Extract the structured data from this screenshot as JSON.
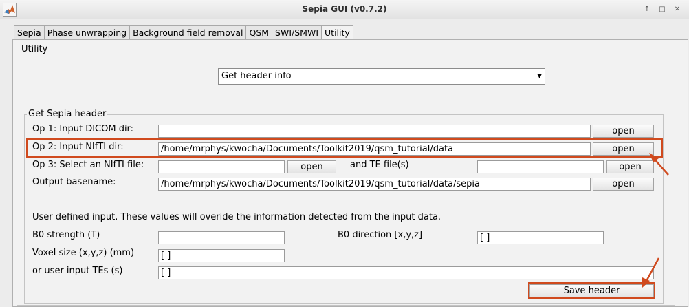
{
  "window": {
    "title": "Sepia GUI (v0.7.2)",
    "controls": [
      "↑",
      "□",
      "✕"
    ]
  },
  "tabs": [
    {
      "label": "Sepia"
    },
    {
      "label": "Phase unwrapping"
    },
    {
      "label": "Background field removal"
    },
    {
      "label": "QSM"
    },
    {
      "label": "SWI/SMWI"
    },
    {
      "label": "Utility"
    }
  ],
  "utility": {
    "panel_title": "Utility",
    "method_select": {
      "value": "Get header info"
    }
  },
  "header_group": {
    "title": "Get Sepia header",
    "op1": {
      "label": "Op 1: Input DICOM dir:",
      "value": "",
      "button": "open"
    },
    "op2": {
      "label": "Op 2: Input NIfTI dir:",
      "value": "/home/mrphys/kwocha/Documents/Toolkit2019/qsm_tutorial/data",
      "button": "open"
    },
    "op3": {
      "label": "Op 3: Select an NIfTI file:",
      "value": "",
      "button": "open",
      "te_label": "and TE file(s)",
      "te_value": "",
      "te_button": "open"
    },
    "output": {
      "label": "Output basename:",
      "value": "/home/mrphys/kwocha/Documents/Toolkit2019/qsm_tutorial/data/sepia",
      "button": "open"
    },
    "user_note": "User defined input. These values will overide the information detected from the input data.",
    "b0_strength": {
      "label": "B0 strength (T)",
      "value": ""
    },
    "b0_direction": {
      "label": "B0 direction [x,y,z]",
      "value": "[ ]"
    },
    "voxel_size": {
      "label": "Voxel size (x,y,z) (mm)",
      "value": "[ ]"
    },
    "user_tes": {
      "label": "or user input TEs (s)",
      "value": "[ ]"
    },
    "save_button": "Save header"
  },
  "annotation_color": "#d04a1e"
}
